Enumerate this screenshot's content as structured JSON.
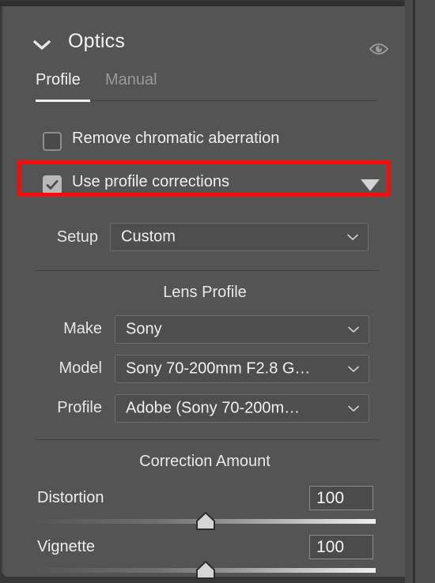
{
  "panel": {
    "title": "Optics",
    "disclosure_icon": "chevron-down-icon",
    "visibility_icon": "eye-icon"
  },
  "tabs": [
    {
      "label": "Profile",
      "active": true
    },
    {
      "label": "Manual",
      "active": false
    }
  ],
  "checkboxes": [
    {
      "label": "Remove chromatic aberration",
      "checked": false,
      "highlighted": false
    },
    {
      "label": "Use profile corrections",
      "checked": true,
      "highlighted": true,
      "expand_icon": "triangle-down-icon"
    }
  ],
  "setup": {
    "label": "Setup",
    "value": "Custom",
    "chevron_icon": "chevron-down-icon"
  },
  "lens_profile": {
    "heading": "Lens Profile",
    "fields": [
      {
        "label": "Make",
        "value": "Sony"
      },
      {
        "label": "Model",
        "value": "Sony 70-200mm F2.8 G…"
      },
      {
        "label": "Profile",
        "value": "Adobe (Sony 70-200m…"
      }
    ]
  },
  "correction_amount": {
    "heading": "Correction Amount",
    "sliders": [
      {
        "label": "Distortion",
        "value": "100",
        "position_pct": 50
      },
      {
        "label": "Vignette",
        "value": "100",
        "position_pct": 50
      }
    ]
  },
  "colors": {
    "panel_background": "#545454",
    "app_background": "#373737",
    "highlight_red": "#fb0a09",
    "text_primary": "#f0f0f0",
    "text_muted": "#9a9a9a",
    "control_background": "#4e4e4e",
    "control_border": "#6e6e6e",
    "checkbox_checked_fill": "#b9b9b9"
  }
}
